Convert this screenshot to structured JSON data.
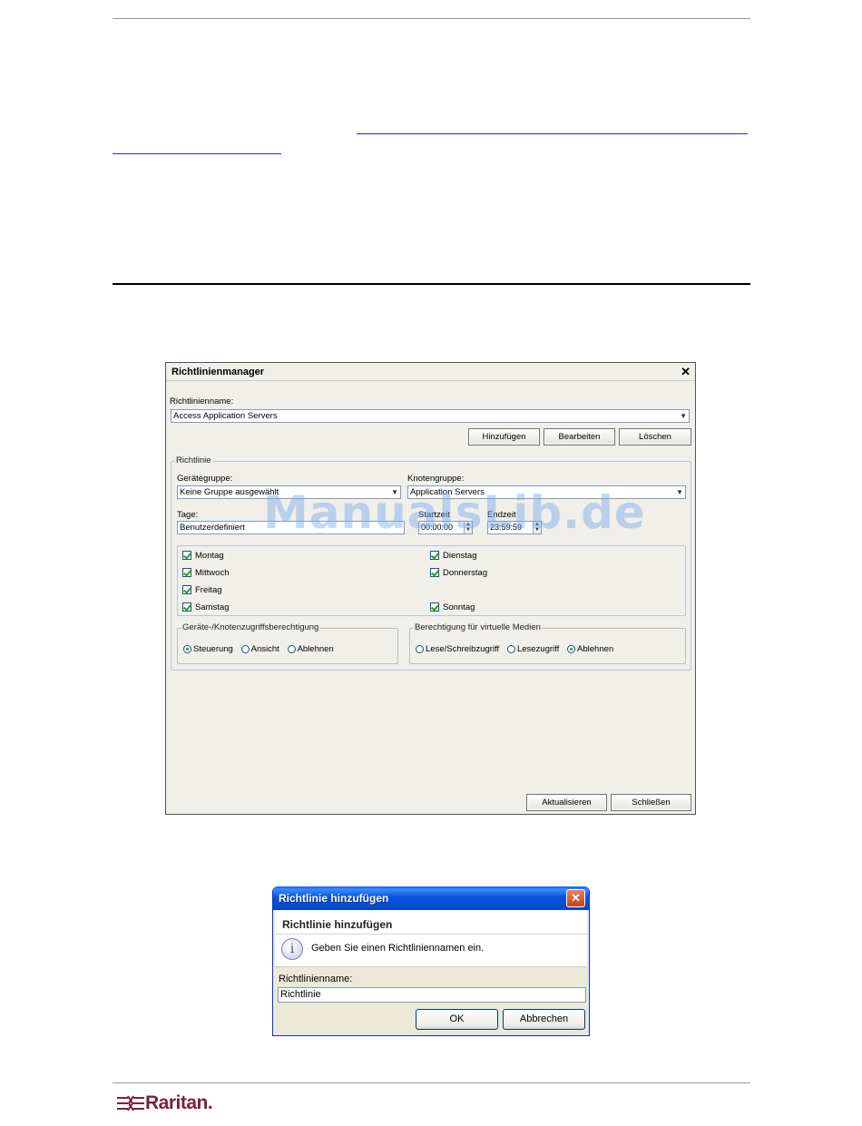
{
  "dialog1": {
    "title": "Richtlinienmanager",
    "close_glyph": "✕",
    "policy_name_label": "Richtlinienname:",
    "policy_name_value": "Access Application Servers",
    "buttons": {
      "add": "Hinzufügen",
      "edit": "Bearbeiten",
      "delete": "Löschen"
    },
    "policy_group_label": "Richtlinie",
    "device_group_label": "Gerätegruppe:",
    "device_group_value": "Keine Gruppe ausgewählt",
    "node_group_label": "Knotengruppe:",
    "node_group_value": "Application Servers",
    "days_label": "Tage:",
    "days_value": "Benutzerdefiniert",
    "start_label": "Startzeit",
    "start_value": "00:00:00",
    "end_label": "Endzeit",
    "end_value": "23:59:59",
    "days": {
      "monday": "Montag",
      "tuesday": "Dienstag",
      "wednesday": "Mittwoch",
      "thursday": "Donnerstag",
      "friday": "Freitag",
      "saturday": "Samstag",
      "sunday": "Sonntag"
    },
    "access_group": {
      "legend": "Geräte-/Knotenzugriffsberechtigung",
      "options": [
        "Steuerung",
        "Ansicht",
        "Ablehnen"
      ],
      "selected": "Steuerung"
    },
    "vm_group": {
      "legend": "Berechtigung für virtuelle Medien",
      "options": [
        "Lese/Schreibzugriff",
        "Lesezugriff",
        "Ablehnen"
      ],
      "selected": "Ablehnen"
    },
    "footer_buttons": {
      "update": "Aktualisieren",
      "close": "Schließen"
    }
  },
  "watermark": "ManualsLib.de",
  "dialog2": {
    "title": "Richtlinie hinzufügen",
    "heading": "Richtlinie hinzufügen",
    "info_glyph": "i",
    "message": "Geben Sie einen Richtliniennamen ein.",
    "field_label": "Richtlinienname:",
    "field_value": "Richtlinie",
    "ok": "OK",
    "cancel": "Abbrechen",
    "close_glyph": "✕"
  },
  "footer": {
    "logo_text": "Raritan."
  },
  "colors": {
    "logo": "#7a1f3c",
    "xp_title": "#0855dd",
    "check": "#21a121"
  }
}
